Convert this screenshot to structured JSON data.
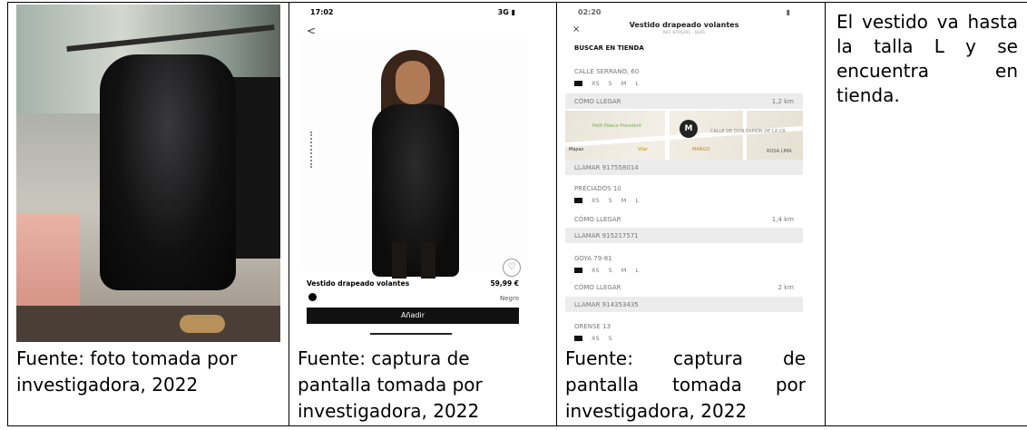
{
  "captions": {
    "col1": [
      "Fuente: foto tomada por",
      "investigadora, 2022"
    ],
    "col2": [
      "Fuente: captura de",
      "pantalla tomada por",
      "investigadora, 2022"
    ],
    "col3": [
      "Fuente:",
      "captura",
      "de",
      "pantalla",
      "tomada",
      "por",
      "investigadora, 2022"
    ]
  },
  "note": "El vestido va hasta la talla L y se encuentra en tienda.",
  "phone1": {
    "time": "17:02",
    "signal": "3G",
    "back": "<",
    "product_name": "Vestido drapeado volantes",
    "price": "59,99 €",
    "color": "Negro",
    "add_button": "Añadir",
    "heart_icon": "♡"
  },
  "phone2": {
    "time": "02:20",
    "close": "×",
    "title": "Vestido drapeado volantes",
    "ref": "REF. 8705291 - 8201",
    "heading": "BUSCAR EN TIENDA",
    "stores": [
      {
        "name": "CALLE SERRANO, 60",
        "directions": "CÓMO LLEGAR",
        "distance": "1,2 km",
        "call": "LLAMAR 917558014"
      },
      {
        "name": "PRECIADOS 10",
        "directions": "CÓMO LLEGAR",
        "distance": "1,4 km",
        "call": "LLAMAR 915217571"
      },
      {
        "name": "GOYA 79-81",
        "directions": "CÓMO LLEGAR",
        "distance": "2 km",
        "call": "LLAMAR 914353435"
      },
      {
        "name": "ORENSE 13"
      }
    ],
    "sizes": [
      "XS",
      "S",
      "M",
      "L"
    ],
    "map_pin": "M",
    "map_labels": [
      "Petit Palace President",
      "Mapas",
      "Vilar",
      "MANGO",
      "CALLE DE DON RAMÓN DE LA CR",
      "ROSA LIMA"
    ]
  }
}
